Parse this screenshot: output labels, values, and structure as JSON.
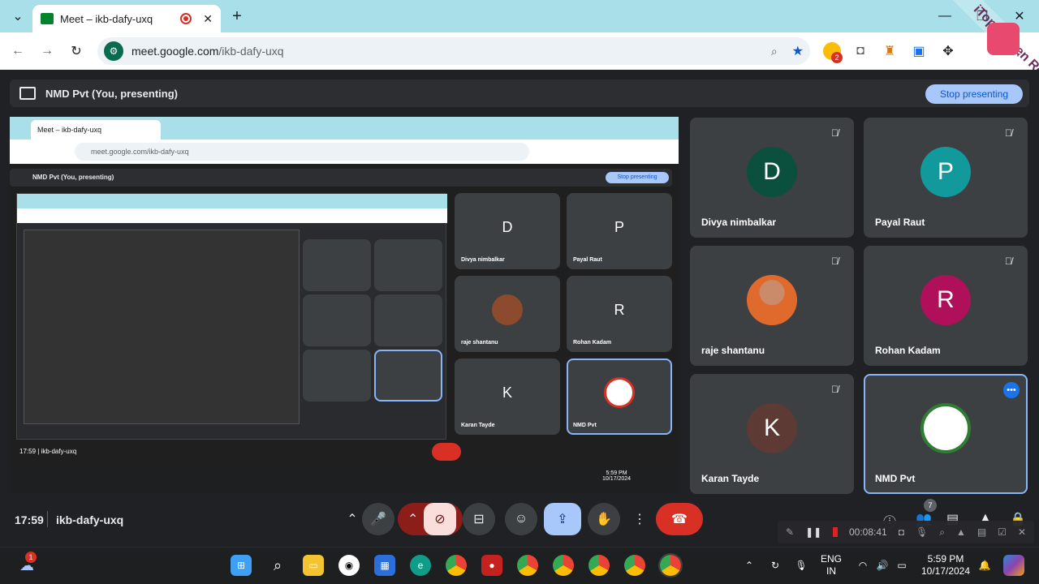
{
  "browser": {
    "tab_title": "Meet – ikb-dafy-uxq",
    "new_tab": "+",
    "url_host": "meet.google.com",
    "url_path": "/ikb-dafy-uxq",
    "ext_badge": "2"
  },
  "watermark": "iTop Screen Recorder",
  "meet": {
    "presenting_label": "NMD Pvt (You, presenting)",
    "stop_presenting": "Stop presenting",
    "participants": [
      {
        "name": "Divya nimbalkar",
        "initial": "D",
        "color": "#0b4f3e"
      },
      {
        "name": "Payal Raut",
        "initial": "P",
        "color": "#12999c"
      },
      {
        "name": "raje shantanu",
        "initial": "",
        "color": "#8c4a2f"
      },
      {
        "name": "Rohan Kadam",
        "initial": "R",
        "color": "#b0105a"
      },
      {
        "name": "Karan Tayde",
        "initial": "K",
        "color": "#5d3a34"
      },
      {
        "name": "NMD Pvt",
        "initial": "",
        "color": "#ffffff"
      }
    ],
    "time": "17:59",
    "meeting_code": "ikb-dafy-uxq",
    "people_count": "7",
    "recorder_time": "00:08:41"
  },
  "taskbar": {
    "weather_badge": "1",
    "lang_top": "ENG",
    "lang_bottom": "IN",
    "clock_time": "5:59 PM",
    "clock_date": "10/17/2024"
  },
  "colors": {
    "end_call": "#d93025",
    "accent": "#a8c7fa",
    "tabbar": "#a8dfe8"
  }
}
